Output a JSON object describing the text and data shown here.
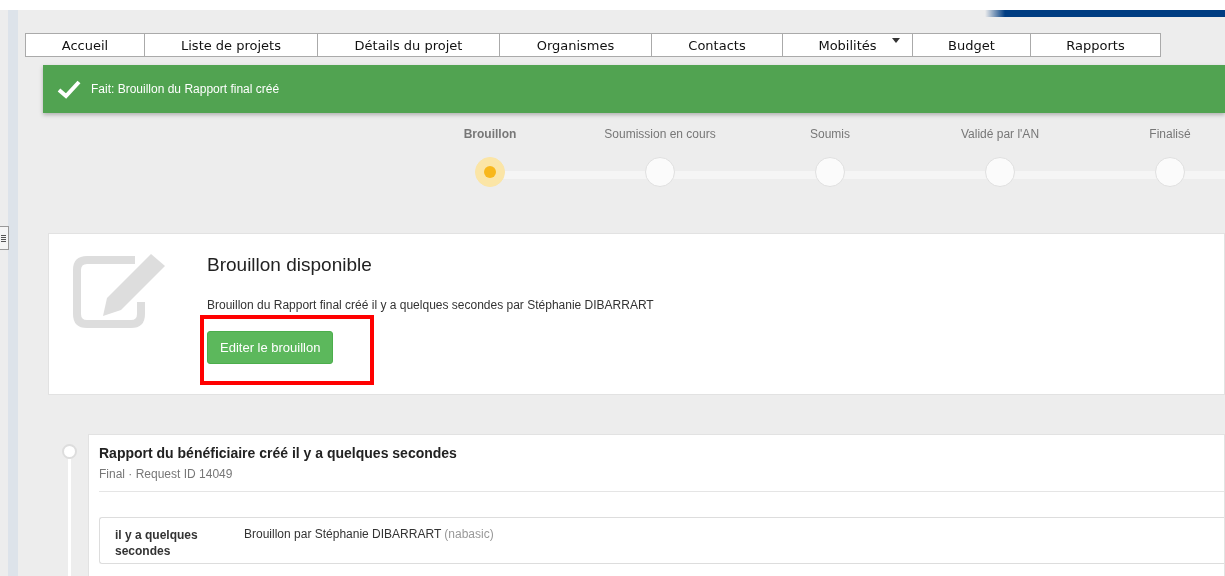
{
  "nav": [
    {
      "label": "Accueil",
      "dropdown": false
    },
    {
      "label": "Liste de projets",
      "dropdown": false
    },
    {
      "label": "Détails du projet",
      "dropdown": false
    },
    {
      "label": "Organismes",
      "dropdown": false
    },
    {
      "label": "Contacts",
      "dropdown": false
    },
    {
      "label": "Mobilités",
      "dropdown": true
    },
    {
      "label": "Budget",
      "dropdown": false
    },
    {
      "label": "Rapports",
      "dropdown": false
    }
  ],
  "alert": {
    "text": "Fait: Brouillon du Rapport final créé"
  },
  "steps": [
    {
      "label": "Brouillon",
      "selected": true
    },
    {
      "label": "Soumission en cours",
      "selected": false
    },
    {
      "label": "Soumis",
      "selected": false
    },
    {
      "label": "Validé par l'AN",
      "selected": false
    },
    {
      "label": "Finalisé",
      "selected": false
    }
  ],
  "draft_card": {
    "title": "Brouillon disponible",
    "text": "Brouillon du Rapport final créé il y a quelques secondes par Stéphanie DIBARRART",
    "button": "Editer le brouillon",
    "highlighted": true
  },
  "timeline": [
    {
      "title": "Rapport du bénéficiaire créé il y a quelques secondes",
      "subtitle": "Final · Request ID 14049",
      "entries": [
        {
          "time": "il y a quelques secondes",
          "text": "Brouillon par Stéphanie DIBARRART",
          "user": "(nabasic)"
        }
      ]
    }
  ]
}
